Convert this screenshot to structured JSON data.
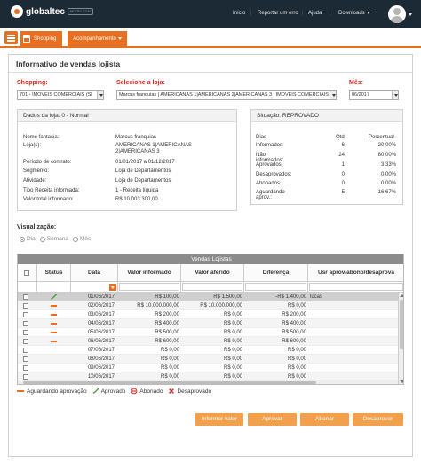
{
  "topbar": {
    "logo_text": "globaltec",
    "logo_badge": "NEXTEL.COM",
    "nav": [
      {
        "label": "Início"
      },
      {
        "label": "Reportar um erro"
      },
      {
        "label": "Ajuda"
      },
      {
        "label": "Downloads"
      }
    ]
  },
  "menubar": {
    "tab_shopping": "Shopping",
    "tab_acompanhamento": "Acompanhamento"
  },
  "page": {
    "title": "Informativo de vendas lojista"
  },
  "filters": {
    "shopping_label": "Shopping:",
    "shopping_value": "701 - IMOVEIS COMERCIAIS (SI",
    "loja_label": "Selecione a loja:",
    "loja_value": "Marcus franquias | AMERICANAS 1|AMERICANAS 2|AMERICANAS 3 | IMOVEIS COMERCIAIS",
    "mes_label": "Mês:",
    "mes_value": "06/2017"
  },
  "loja": {
    "header": "Dados da loja: 0 - Normal",
    "fields": [
      {
        "label": "Nome fantasia:",
        "value": "Marcus franquias"
      },
      {
        "label": "Loja(s):",
        "value": "AMERICANAS 1|AMERICANAS 2|AMERICANAS 3"
      },
      {
        "label": "Período de contrato:",
        "value": "01/01/2017 a 01/12/2017"
      },
      {
        "label": "Segmento:",
        "value": "Loja de Departamentos"
      },
      {
        "label": "Atividade:",
        "value": "Loja de Departamentos"
      },
      {
        "label": "Tipo Receita informada:",
        "value": "1 - Receita líquida"
      },
      {
        "label": "Valor total informado:",
        "value": "R$ 10.003.300,00"
      }
    ]
  },
  "situacao": {
    "header": "Situação: REPROVADO",
    "col_dias": "Dias",
    "col_qtd": "Qtd",
    "col_pct": "Percentual",
    "rows": [
      {
        "label": "Informados:",
        "qtd": "6",
        "pct": "20,00%"
      },
      {
        "label": "Não informados:",
        "qtd": "24",
        "pct": "80,00%"
      },
      {
        "label": "Aprovados:",
        "qtd": "1",
        "pct": "3,33%"
      },
      {
        "label": "Desaprovados:",
        "qtd": "0",
        "pct": "0,00%"
      },
      {
        "label": "Abonados:",
        "qtd": "0",
        "pct": "0,00%"
      },
      {
        "label": "Aguardando aprov.:",
        "qtd": "5",
        "pct": "16,67%"
      }
    ]
  },
  "visualizacao": {
    "label": "Visualização:",
    "options": [
      "Dia",
      "Semana",
      "Mês"
    ],
    "selected": "Dia"
  },
  "grid": {
    "title": "Vendas Lojistas",
    "headers": {
      "status": "Status",
      "data": "Data",
      "valor_informado": "Valor informado",
      "valor_aferido": "Valor aferido",
      "diferenca": "Diferença",
      "usuario": "Usr aprov/abono/desaprova"
    },
    "rows": [
      {
        "status": "aprovado",
        "data": "01/06/2017",
        "informado": "R$ 100,00",
        "aferido": "R$ 1.500,00",
        "diferenca": "-R$ 1.400,00",
        "usuario": "lucas"
      },
      {
        "status": "aguardando",
        "data": "02/06/2017",
        "informado": "R$ 10.000.000,00",
        "aferido": "R$ 10.000.000,00",
        "diferenca": "R$ 0,00",
        "usuario": ""
      },
      {
        "status": "aguardando",
        "data": "03/06/2017",
        "informado": "R$ 200,00",
        "aferido": "R$ 0,00",
        "diferenca": "R$ 200,00",
        "usuario": ""
      },
      {
        "status": "aguardando",
        "data": "04/06/2017",
        "informado": "R$ 400,00",
        "aferido": "R$ 0,00",
        "diferenca": "R$ 400,00",
        "usuario": ""
      },
      {
        "status": "aguardando",
        "data": "05/06/2017",
        "informado": "R$ 500,00",
        "aferido": "R$ 0,00",
        "diferenca": "R$ 500,00",
        "usuario": ""
      },
      {
        "status": "aguardando",
        "data": "06/06/2017",
        "informado": "R$ 600,00",
        "aferido": "R$ 0,00",
        "diferenca": "R$ 600,00",
        "usuario": ""
      },
      {
        "status": "",
        "data": "07/06/2017",
        "informado": "R$ 0,00",
        "aferido": "R$ 0,00",
        "diferenca": "R$ 0,00",
        "usuario": ""
      },
      {
        "status": "",
        "data": "08/06/2017",
        "informado": "R$ 0,00",
        "aferido": "R$ 0,00",
        "diferenca": "R$ 0,00",
        "usuario": ""
      },
      {
        "status": "",
        "data": "09/06/2017",
        "informado": "R$ 0,00",
        "aferido": "R$ 0,00",
        "diferenca": "R$ 0,00",
        "usuario": ""
      },
      {
        "status": "",
        "data": "10/06/2017",
        "informado": "R$ 0,00",
        "aferido": "R$ 0,00",
        "diferenca": "R$ 0,00",
        "usuario": ""
      }
    ]
  },
  "legend": {
    "aguardando": "Aguardando aprovação",
    "aprovado": "Aprovado",
    "abonado": "Abonado",
    "desaprovado": "Desaprovado"
  },
  "actions": {
    "informar": "Informar valor",
    "aprovar": "Aprovar",
    "abonar": "Abonar",
    "desaprovar": "Desaprovar"
  },
  "colors": {
    "accent": "#e86f22",
    "button": "#f2a04c",
    "topbar": "#1b2a35",
    "label_red": "#e0251b"
  }
}
